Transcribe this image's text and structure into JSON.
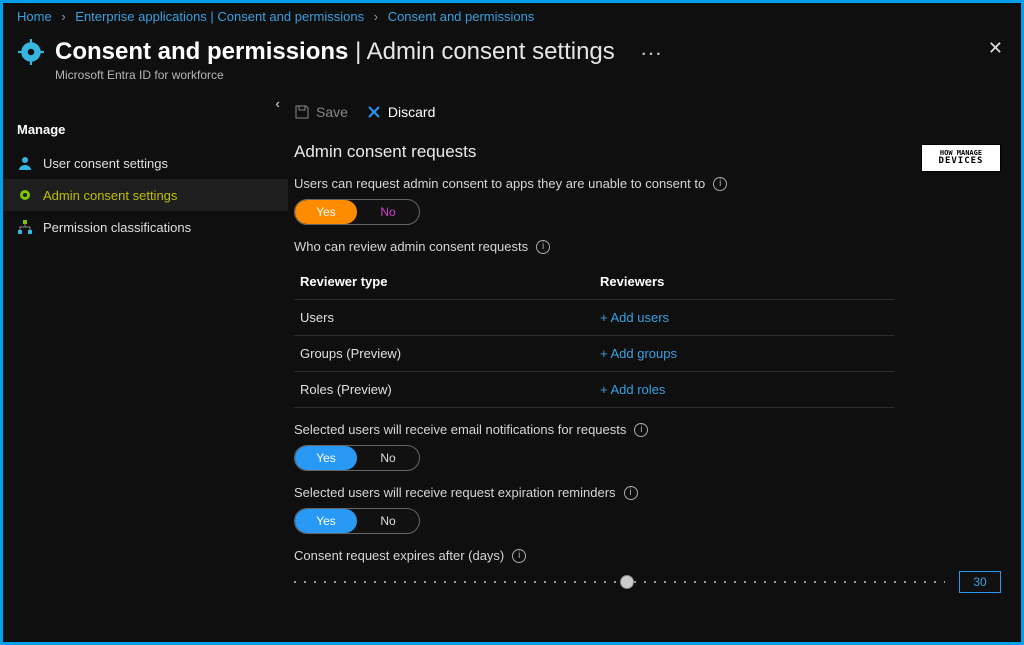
{
  "breadcrumb": {
    "home": "Home",
    "item1": "Enterprise applications | Consent and permissions",
    "item2": "Consent and permissions"
  },
  "header": {
    "title_left": "Consent and permissions",
    "title_right": "Admin consent settings",
    "subtitle": "Microsoft Entra ID for workforce"
  },
  "sidebar": {
    "heading": "Manage",
    "items": [
      {
        "label": "User consent settings"
      },
      {
        "label": "Admin consent settings"
      },
      {
        "label": "Permission classifications"
      }
    ]
  },
  "toolbar": {
    "save": "Save",
    "discard": "Discard"
  },
  "section": {
    "title": "Admin consent requests",
    "field1_label": "Users can request admin consent to apps they are unable to consent to",
    "toggle_yes": "Yes",
    "toggle_no": "No",
    "field2_label": "Who can review admin consent requests",
    "table": {
      "header_type": "Reviewer type",
      "header_reviewers": "Reviewers",
      "rows": [
        {
          "type": "Users",
          "action": "+ Add users"
        },
        {
          "type": "Groups (Preview)",
          "action": "+ Add groups"
        },
        {
          "type": "Roles (Preview)",
          "action": "+ Add roles"
        }
      ]
    },
    "field3_label": "Selected users will receive email notifications for requests",
    "field4_label": "Selected users will receive request expiration reminders",
    "field5_label": "Consent request expires after (days)",
    "slider_value": "30"
  },
  "watermark": {
    "line1": "HOW MANAGE",
    "line2": "DEVICES"
  }
}
